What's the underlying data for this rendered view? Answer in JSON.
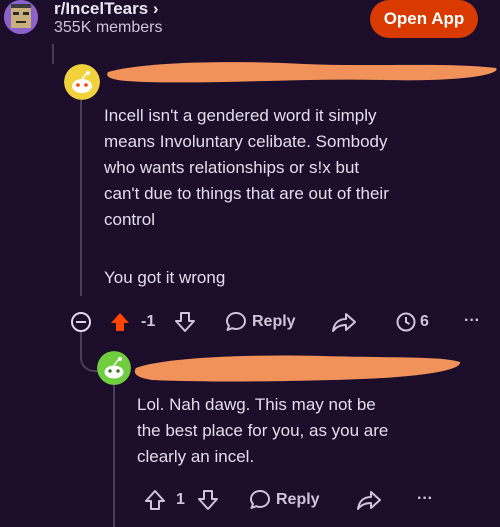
{
  "header": {
    "subreddit": "r/IncelTears",
    "chevron": "›",
    "members": "355K members",
    "open_app": "Open App"
  },
  "comments": [
    {
      "avatar_icon": "snoo-yellow-avatar",
      "paragraphs": [
        "Incell isn't a gendered word it simply",
        "means Involuntary celibate. Sombody",
        "who wants relationships or s!x but",
        "can't due to things that are out of their",
        "control",
        "You got it wrong"
      ],
      "actions": {
        "vote_count": "-1",
        "reply": "Reply",
        "awards_count": "6",
        "more": "···"
      },
      "upvoted_color": "#ff4500"
    },
    {
      "avatar_icon": "snoo-green-avatar",
      "paragraphs": [
        "Lol. Nah dawg. This may not be",
        "the best place for you, as you are",
        "clearly an incel."
      ],
      "actions": {
        "vote_count": "1",
        "reply": "Reply",
        "more": "···"
      }
    }
  ],
  "colors": {
    "background": "#1c0e2b",
    "accent": "#d93a00",
    "redaction": "#f0925a"
  }
}
